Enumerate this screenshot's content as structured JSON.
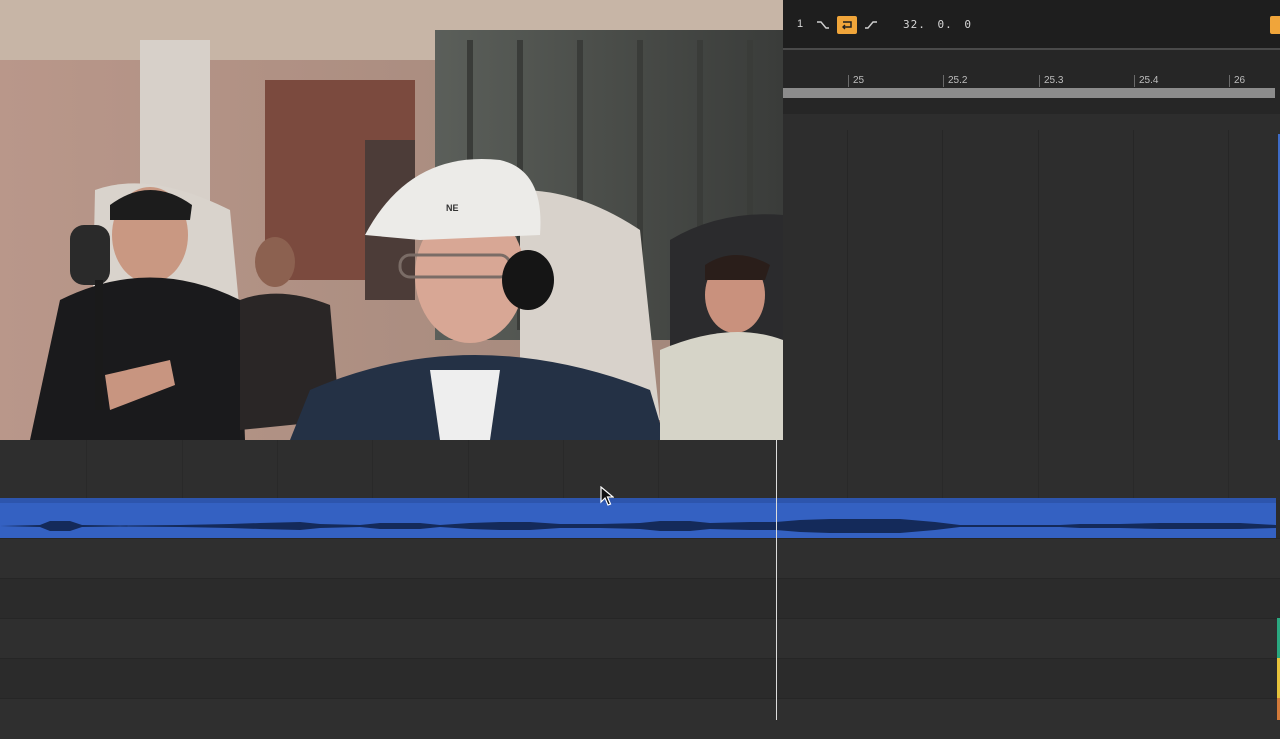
{
  "transport": {
    "bar_number": "1",
    "loop_length": "32. 0. 0",
    "buttons": [
      "fade-in-icon",
      "loop-icon",
      "fade-out-icon"
    ],
    "accent_color": "#f0a53a"
  },
  "ruler": {
    "markers": [
      "25",
      "25.2",
      "25.3",
      "25.4",
      "26"
    ]
  },
  "clip": {
    "color": "#3461c2"
  },
  "video": {
    "brand_logo": "NE"
  }
}
